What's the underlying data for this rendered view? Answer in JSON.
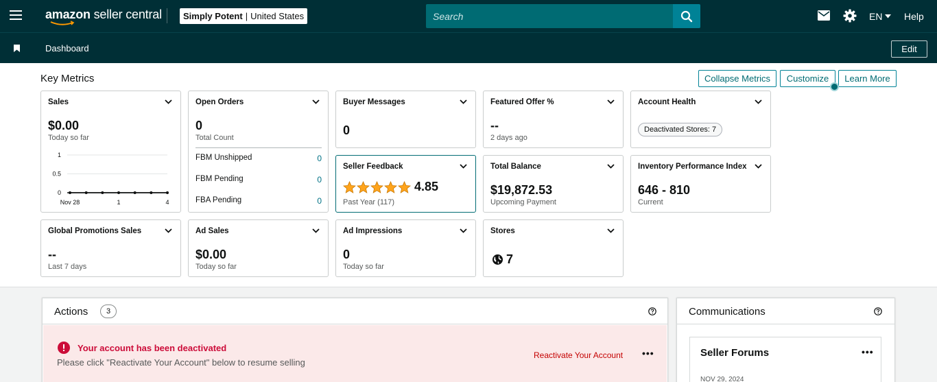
{
  "topbar": {
    "logo_amazon": "amazon",
    "logo_rest": " seller central",
    "store_name": "Simply Potent",
    "store_sep": "|",
    "store_region": "United States",
    "search_placeholder": "Search",
    "language": "EN",
    "help": "Help"
  },
  "subbar": {
    "dashboard": "Dashboard",
    "edit": "Edit"
  },
  "key_metrics": {
    "title": "Key Metrics",
    "buttons": {
      "collapse": "Collapse Metrics",
      "customize": "Customize",
      "learn_more": "Learn More"
    },
    "sales": {
      "title": "Sales",
      "value": "$0.00",
      "sub": "Today so far"
    },
    "open_orders": {
      "title": "Open Orders",
      "value": "0",
      "sub": "Total Count",
      "rows": [
        {
          "label": "FBM Unshipped",
          "value": "0"
        },
        {
          "label": "FBM Pending",
          "value": "0"
        },
        {
          "label": "FBA Pending",
          "value": "0"
        }
      ]
    },
    "buyer_messages": {
      "title": "Buyer Messages",
      "value": "0"
    },
    "featured_offer": {
      "title": "Featured Offer %",
      "value": "--",
      "sub": "2 days ago"
    },
    "account_health": {
      "title": "Account Health",
      "pill": "Deactivated Stores: 7"
    },
    "seller_feedback": {
      "title": "Seller Feedback",
      "rating": "4.85",
      "stars": 5,
      "sub": "Past Year (117)"
    },
    "total_balance": {
      "title": "Total Balance",
      "value": "$19,872.53",
      "sub": "Upcoming Payment"
    },
    "inventory_index": {
      "title": "Inventory Performance Index",
      "value": "646 - 810",
      "sub": "Current"
    },
    "global_promotions": {
      "title": "Global Promotions Sales",
      "value": "--",
      "sub": "Last 7 days"
    },
    "ad_sales": {
      "title": "Ad Sales",
      "value": "$0.00",
      "sub": "Today so far"
    },
    "ad_impressions": {
      "title": "Ad Impressions",
      "value": "0",
      "sub": "Today so far"
    },
    "stores": {
      "title": "Stores",
      "value": "7"
    }
  },
  "chart_data": {
    "type": "line",
    "x": [
      "Nov 28",
      "",
      "",
      "1",
      "",
      "",
      "4"
    ],
    "xticks": [
      "Nov 28",
      "1",
      "4"
    ],
    "yticks": [
      "1",
      "0.5",
      "0"
    ],
    "ylim": [
      0,
      1
    ],
    "series": [
      {
        "values": [
          0,
          0,
          0,
          0,
          0,
          0,
          0
        ]
      }
    ],
    "grid": true
  },
  "actions": {
    "title": "Actions",
    "count": "3",
    "alert_title": "Your account has been deactivated",
    "alert_desc": "Please click \"Reactivate Your Account\" below to resume selling",
    "alert_link": "Reactivate Your Account",
    "more": "•••"
  },
  "communications": {
    "title": "Communications",
    "forum_title": "Seller Forums",
    "forum_date": "NOV 29, 2024",
    "more": "•••"
  },
  "colors": {
    "header": "#002f36",
    "accent": "#006b73",
    "alert_bg": "#fbe9e9",
    "alert_text": "#cc0c39"
  }
}
